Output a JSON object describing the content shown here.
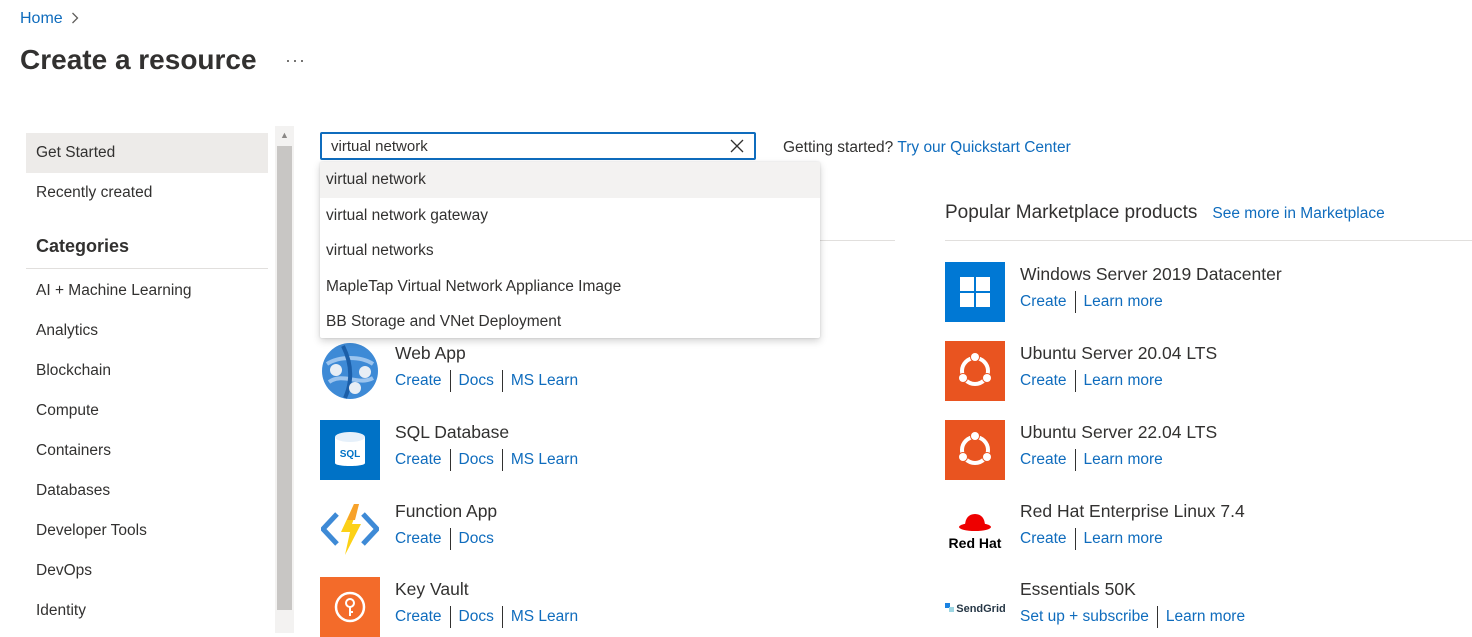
{
  "header": {
    "breadcrumb_home": "Home",
    "title": "Create a resource",
    "more": "···"
  },
  "sidebar": {
    "items": [
      {
        "label": "Get Started",
        "selected": true
      },
      {
        "label": "Recently created"
      }
    ],
    "categories_heading": "Categories",
    "categories": [
      "AI + Machine Learning",
      "Analytics",
      "Blockchain",
      "Compute",
      "Containers",
      "Databases",
      "Developer Tools",
      "DevOps",
      "Identity"
    ]
  },
  "search": {
    "value": "virtual network",
    "suggestions": [
      "virtual network",
      "virtual network gateway",
      "virtual networks",
      "MapleTap Virtual Network Appliance Image",
      "BB Storage and VNet Deployment"
    ]
  },
  "quickstart": {
    "prefix": "Getting started?",
    "link": "Try our Quickstart Center"
  },
  "popular_azure": [
    {
      "name": "Web App",
      "links": [
        "Create",
        "Docs",
        "MS Learn"
      ],
      "icon": "web-app-icon"
    },
    {
      "name": "SQL Database",
      "links": [
        "Create",
        "Docs",
        "MS Learn"
      ],
      "icon": "sql-database-icon",
      "icon_text": "SQL"
    },
    {
      "name": "Function App",
      "links": [
        "Create",
        "Docs"
      ],
      "icon": "function-app-icon"
    },
    {
      "name": "Key Vault",
      "links": [
        "Create",
        "Docs",
        "MS Learn"
      ],
      "icon": "key-vault-icon"
    }
  ],
  "marketplace": {
    "heading": "Popular Marketplace products",
    "see_more": "See more in Marketplace",
    "items": [
      {
        "name": "Windows Server 2019 Datacenter",
        "links": [
          "Create",
          "Learn more"
        ],
        "icon": "windows-logo-icon"
      },
      {
        "name": "Ubuntu Server 20.04 LTS",
        "links": [
          "Create",
          "Learn more"
        ],
        "icon": "ubuntu-logo-icon"
      },
      {
        "name": "Ubuntu Server 22.04 LTS",
        "links": [
          "Create",
          "Learn more"
        ],
        "icon": "ubuntu-logo-icon"
      },
      {
        "name": "Red Hat Enterprise Linux 7.4",
        "links": [
          "Create",
          "Learn more"
        ],
        "icon": "redhat-logo-icon",
        "logo_text": "Red Hat"
      },
      {
        "name": "Essentials 50K",
        "links": [
          "Set up + subscribe",
          "Learn more"
        ],
        "icon": "sendgrid-logo-icon",
        "logo_text": "SendGrid"
      }
    ]
  },
  "colors": {
    "link": "#0f6cbd",
    "selected_bg": "#edebe9",
    "windows_blue": "#0078d4",
    "ubuntu_orange": "#e95420",
    "redhat_red": "#ee0000",
    "sql_blue": "#0072c6",
    "keyvault_orange": "#f36b2a"
  }
}
